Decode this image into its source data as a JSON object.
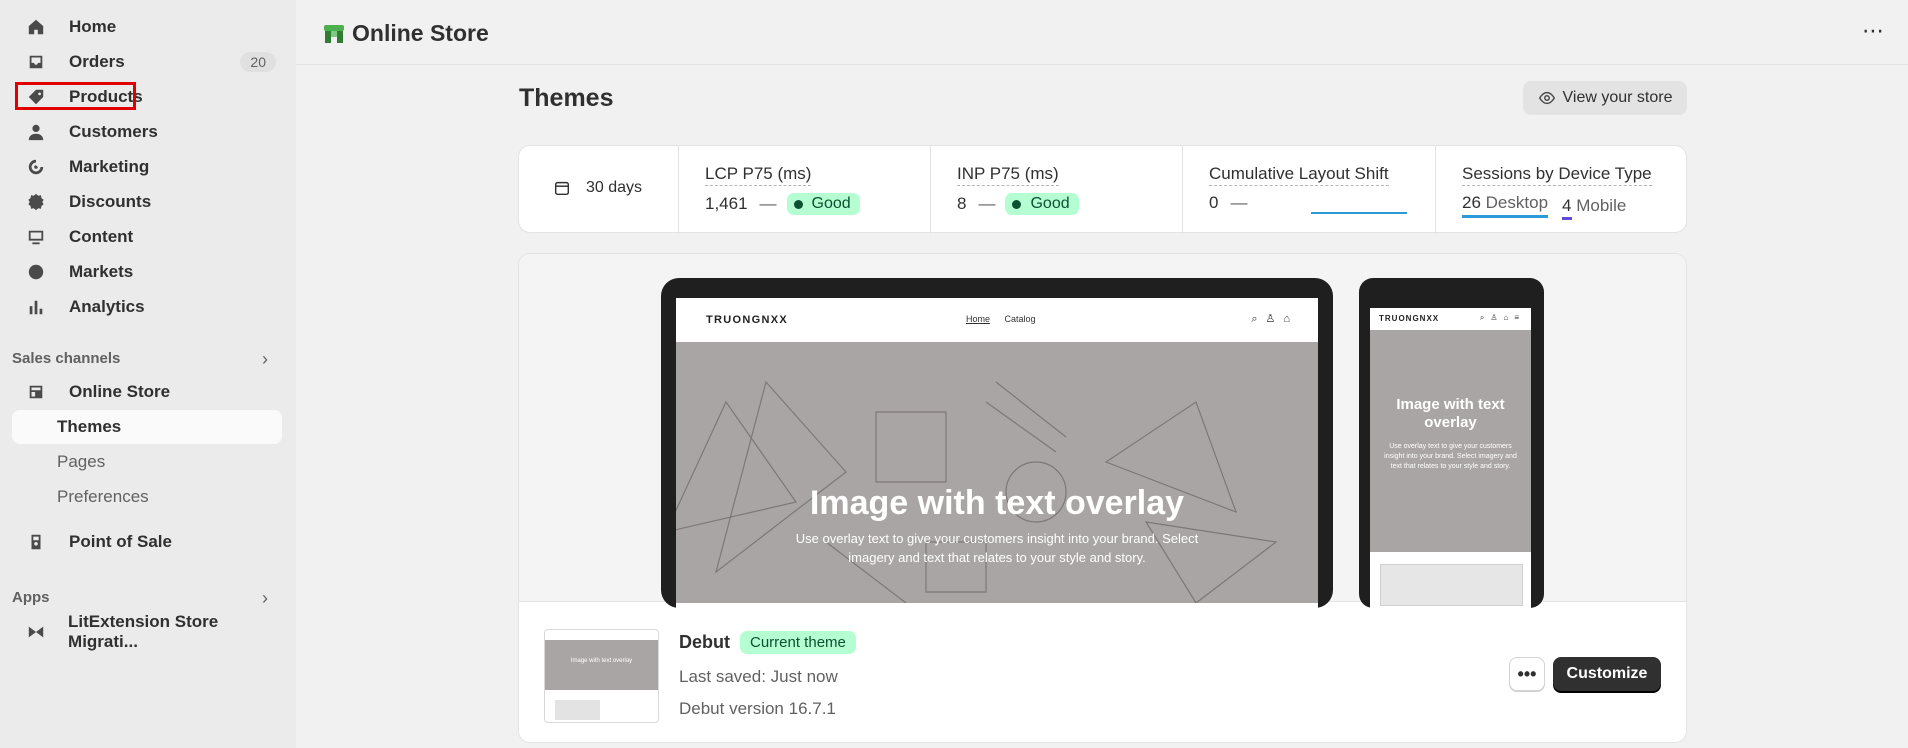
{
  "sidebar": {
    "nav": [
      {
        "label": "Home",
        "icon": "home-icon"
      },
      {
        "label": "Orders",
        "icon": "inbox-icon",
        "badge": "20"
      },
      {
        "label": "Products",
        "icon": "tag-icon"
      },
      {
        "label": "Customers",
        "icon": "person-icon"
      },
      {
        "label": "Marketing",
        "icon": "target-icon"
      },
      {
        "label": "Discounts",
        "icon": "discount-icon"
      },
      {
        "label": "Content",
        "icon": "content-icon"
      },
      {
        "label": "Markets",
        "icon": "globe-icon"
      },
      {
        "label": "Analytics",
        "icon": "bar-chart-icon"
      }
    ],
    "sales_channels_label": "Sales channels",
    "online_store": "Online Store",
    "sub_items": [
      "Themes",
      "Pages",
      "Preferences"
    ],
    "point_of_sale": "Point of Sale",
    "apps_label": "Apps",
    "app_item": "LitExtension Store Migrati..."
  },
  "topbar": {
    "title": "Online Store",
    "more": "⋯"
  },
  "main": {
    "title": "Themes",
    "view_store": "View your store",
    "metrics": {
      "period": "30 days",
      "lcp": {
        "title": "LCP P75 (ms)",
        "value": "1,461",
        "dash": "—",
        "status": "Good"
      },
      "inp": {
        "title": "INP P75 (ms)",
        "value": "8",
        "dash": "—",
        "status": "Good"
      },
      "cls": {
        "title": "Cumulative Layout Shift",
        "value": "0",
        "dash": "—"
      },
      "sessions": {
        "title": "Sessions by Device Type",
        "desktop_count": "26",
        "desktop_label": "Desktop",
        "mobile_count": "4",
        "mobile_label": "Mobile"
      }
    },
    "preview": {
      "brand": "TRUONGNXX",
      "nav": [
        "Home",
        "Catalog"
      ],
      "hero_title": "Image with text overlay",
      "hero_sub": "Use overlay text to give your customers insight into your brand. Select imagery and text that relates to your style and story.",
      "phone_title": "Image with text overlay",
      "phone_sub": "Use overlay text to give your customers insight into your brand. Select imagery and text that relates to your style and story."
    },
    "theme": {
      "name": "Debut",
      "badge": "Current theme",
      "saved": "Last saved: Just now",
      "version": "Debut version 16.7.1",
      "more": "•••",
      "customize": "Customize"
    }
  },
  "colors": {
    "accent_good": "#b4fed2",
    "highlight_outline": "#e00000",
    "primary_button": "#303030"
  }
}
